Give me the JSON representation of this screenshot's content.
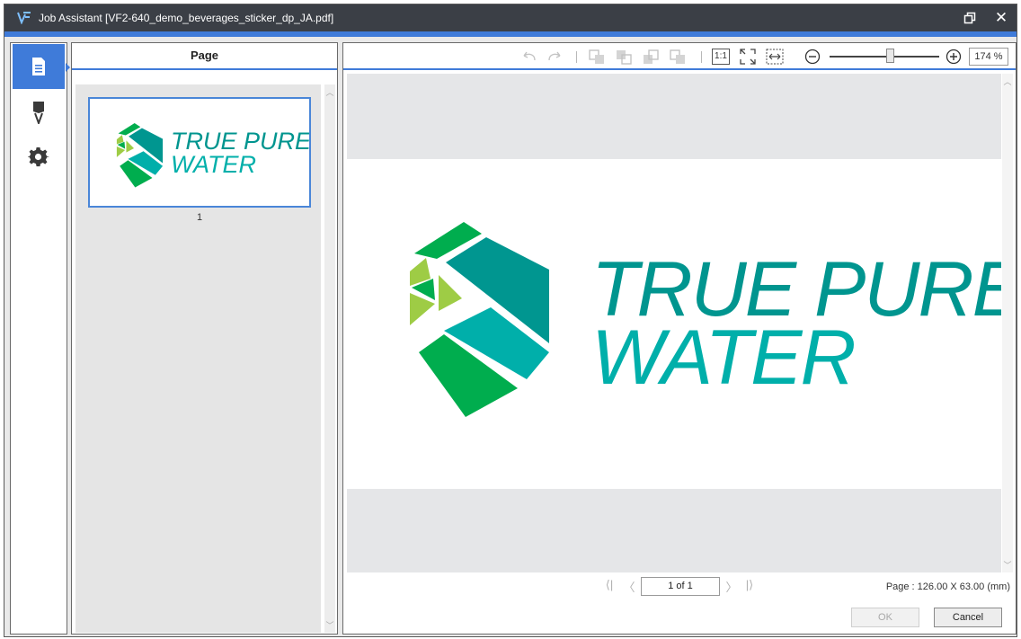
{
  "window": {
    "title": "Job Assistant [VF2-640_demo_beverages_sticker_dp_JA.pdf]",
    "restore_icon": "restore-window-icon",
    "close_icon": "close-icon"
  },
  "rail": {
    "items": [
      {
        "name": "page",
        "icon": "document-icon",
        "active": true
      },
      {
        "name": "marks",
        "icon": "marker-icon",
        "active": false
      },
      {
        "name": "settings",
        "icon": "gear-icon",
        "active": false
      }
    ]
  },
  "page_panel": {
    "header": "Page",
    "thumbnails": [
      {
        "label": "1",
        "logo_line1": "TRUE PURE",
        "logo_line2": "WATER"
      }
    ]
  },
  "preview": {
    "toolbar_icons": [
      "undo-icon",
      "redo-icon",
      "send-to-back-icon",
      "send-backward-icon",
      "bring-forward-icon",
      "bring-to-front-icon",
      "actual-size-icon",
      "fit-page-icon",
      "fit-width-icon",
      "zoom-out-icon",
      "zoom-in-icon"
    ],
    "actual_size_label": "1:1",
    "zoom_value": "174 %",
    "zoom_level_fraction": 0.55,
    "logo_line1": "TRUE PURE",
    "logo_line2": "WATER",
    "page_indicator": "1 of 1",
    "page_size": "Page : 126.00 X 63.00 (mm)"
  },
  "buttons": {
    "ok": "OK",
    "cancel": "Cancel"
  },
  "colors": {
    "accent_blue": "#3f7bd9",
    "titlebar": "#3b3f46",
    "logo_teal_dark": "#009690",
    "logo_teal": "#00afaa",
    "logo_green": "#00ad4e",
    "logo_lime": "#9ecc45"
  }
}
